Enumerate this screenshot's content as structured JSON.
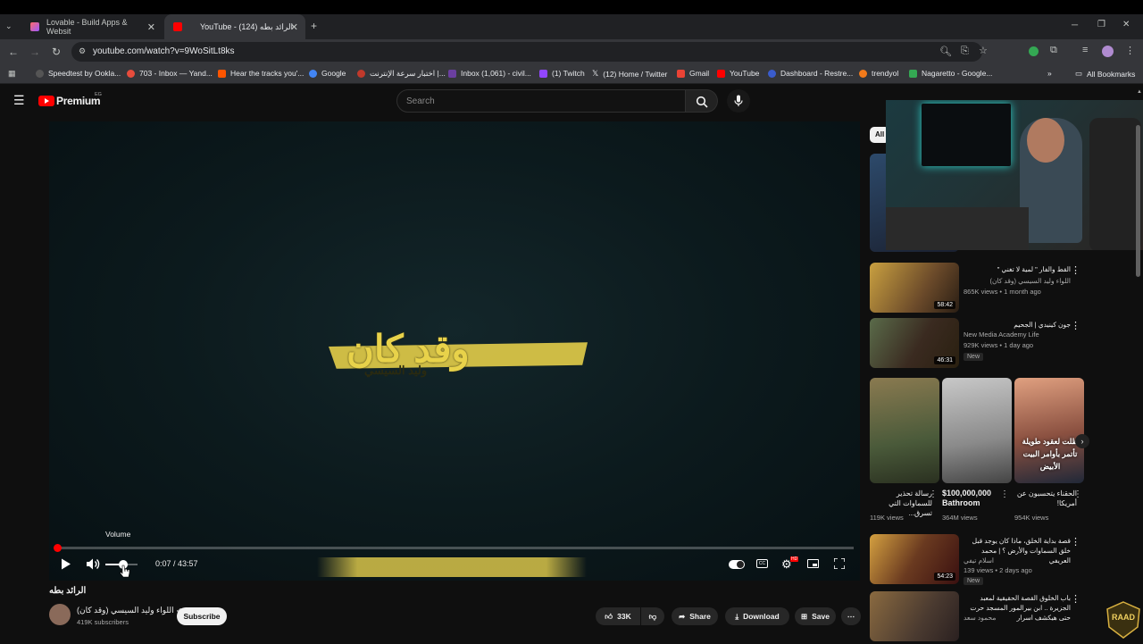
{
  "browser": {
    "tabs": [
      {
        "label": "Lovable - Build Apps & Websit",
        "active": false
      },
      {
        "label": "YouTube - الرائد بطه (124)",
        "active": true
      }
    ],
    "new_tab": "+",
    "url": "youtube.com/watch?v=9WoSitLt8ks",
    "bookmarks": [
      "Speedtest by Ookla...",
      "703 - Inbox — Yand...",
      "Hear the tracks you'...",
      "Google",
      "اختبار سرعة الإنترنت |...",
      "Inbox (1,061) - civil...",
      "(1) Twitch",
      "(12) Home / Twitter",
      "Gmail",
      "YouTube",
      "Dashboard - Restre...",
      "trendyol",
      "Nagaretto - Google..."
    ],
    "all_bookmarks": "All Bookmarks",
    "more_bookmarks": "»"
  },
  "masthead": {
    "logo": "Premium",
    "region": "EG",
    "search_placeholder": "Search"
  },
  "player": {
    "art_title": "وقد كان",
    "art_subtitle": "وليد السيسي",
    "time": "0:07 / 43:57",
    "progress": 0.0027,
    "volume_tooltip": "Volume",
    "volume_level": 0.55,
    "hd_badge": "HD"
  },
  "video": {
    "title": "الرائد بطه",
    "channel": "اللواء وليد السيسي (وقد كان)",
    "subscribers": "419K subscribers",
    "subscribe": "Subscribe",
    "likes": "33K",
    "share": "Share",
    "download": "Download",
    "save": "Save"
  },
  "sidebar": {
    "chip_all": "All",
    "recs": [
      {
        "title": "القط والفار \" لمية لا تغني \"",
        "channel": "اللواء وليد السيسي (وقد كان)",
        "meta": "865K views • 1 month ago",
        "duration": "58:42",
        "new": ""
      },
      {
        "title": "جون كينيدي | الجحيم",
        "channel": "New Media Academy Life",
        "meta": "929K views • 1 day ago",
        "duration": "46:31",
        "new": "New"
      },
      {
        "title": "قصة بداية الخلق، ماذا كان يوجد قبل خلق السماوات والأرض ؟ | محمد العريفي",
        "channel": "اسلام تيفي",
        "meta": "139 views • 2 days ago",
        "duration": "54:23",
        "new": "New"
      },
      {
        "title": "باب الخلوق القصة الحقيقية لمعبد الجزيرة .. ابن بيرالمور المسجد حرت حتى هيكشف اسرار",
        "channel": "محمود سعد",
        "meta": "",
        "duration": "",
        "new": ""
      }
    ],
    "shorts": [
      {
        "title": "رسالة تحذير للسماوات التي تسرق...",
        "views": "119K views"
      },
      {
        "title": "$100,000,000 Bathroom",
        "views": "364M views"
      },
      {
        "title": "الحقناء يتحسبون عن أمريكا!",
        "views": "954K views"
      }
    ],
    "short_overlay": "ظلت لعقود طويلة تأتمر بأوامر البيت الأبيض"
  },
  "colors": {
    "youtube_red": "#ff0000",
    "background": "#0f0f0f",
    "art_yellow": "#e8d24a"
  }
}
